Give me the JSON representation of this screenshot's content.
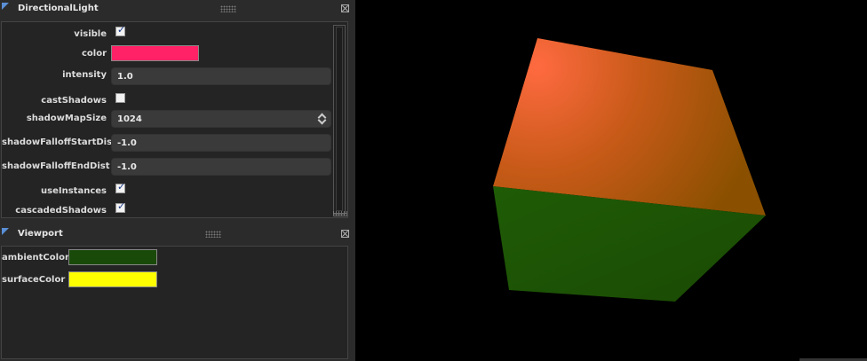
{
  "directional_light": {
    "title": "DirectionalLight",
    "properties": {
      "visible": {
        "label": "visible",
        "checked": true
      },
      "color": {
        "label": "color",
        "value_hex": "#ff2266"
      },
      "intensity": {
        "label": "intensity",
        "value": "1.0"
      },
      "castShadows": {
        "label": "castShadows",
        "checked": false
      },
      "shadowMapSize": {
        "label": "shadowMapSize",
        "value": "1024"
      },
      "shadowFalloffStartDist": {
        "label": "shadowFalloffStartDist",
        "value": "-1.0"
      },
      "shadowFalloffEndDist": {
        "label": "shadowFalloffEndDist",
        "value": "-1.0"
      },
      "useInstances": {
        "label": "useInstances",
        "checked": true
      },
      "cascadedShadows": {
        "label": "cascadedShadows",
        "checked": true
      }
    }
  },
  "viewport_panel": {
    "title": "Viewport",
    "properties": {
      "ambientColor": {
        "label": "ambientColor",
        "value_hex": "#1a4a0a"
      },
      "surfaceColor": {
        "label": "surfaceColor",
        "value_hex": "#ffff00"
      }
    }
  },
  "icons": {
    "panel_toggle": "triangle-icon",
    "drag_handle": "grip-icon",
    "close": "close-icon",
    "check": "checkmark-icon",
    "spinner": "spinner-arrows-icon"
  },
  "accent_color": "#5a8fd6",
  "mark_check": "✓"
}
